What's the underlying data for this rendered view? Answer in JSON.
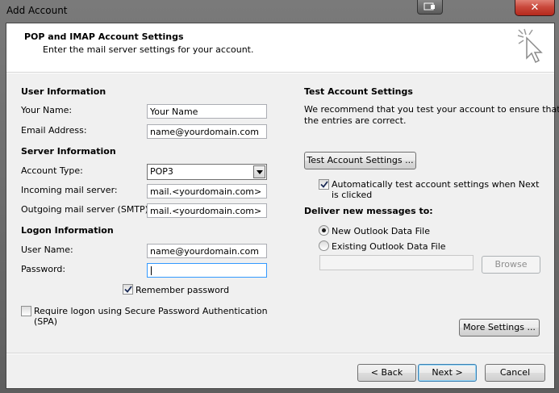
{
  "window": {
    "title": "Add Account",
    "close_glyph": "✕"
  },
  "header": {
    "title": "POP and IMAP Account Settings",
    "subtitle": "Enter the mail server settings for your account.",
    "icon": "cursor-click-icon"
  },
  "user_info": {
    "heading": "User Information",
    "name_label": "Your Name:",
    "name_value": "Your Name",
    "email_label": "Email Address:",
    "email_value": "name@yourdomain.com"
  },
  "server_info": {
    "heading": "Server Information",
    "account_type_label": "Account Type:",
    "account_type_value": "POP3",
    "incoming_label": "Incoming mail server:",
    "incoming_value": "mail.<yourdomain.com>",
    "outgoing_label": "Outgoing mail server (SMTP):",
    "outgoing_value": "mail.<yourdomain.com>"
  },
  "logon_info": {
    "heading": "Logon Information",
    "username_label": "User Name:",
    "username_value": "name@yourdomain.com",
    "password_label": "Password:",
    "password_value": "",
    "remember_label": "Remember password",
    "remember_checked": true,
    "spa_label_line1": "Require logon using Secure Password Authentication",
    "spa_label_line2": "(SPA)",
    "spa_checked": false
  },
  "test_settings": {
    "heading": "Test Account Settings",
    "desc_line1": "We recommend that you test your account to ensure that",
    "desc_line2": "the entries are correct.",
    "test_button": "Test Account Settings ...",
    "auto_test_line1": "Automatically test account settings when Next",
    "auto_test_line2": "is clicked",
    "auto_test_checked": true
  },
  "deliver": {
    "heading": "Deliver new messages to:",
    "new_file_label": "New Outlook Data File",
    "existing_file_label": "Existing Outlook Data File",
    "existing_path_value": "",
    "browse_button": "Browse"
  },
  "more_settings_button": "More Settings ...",
  "nav": {
    "back": "< Back",
    "next": "Next >",
    "cancel": "Cancel"
  }
}
